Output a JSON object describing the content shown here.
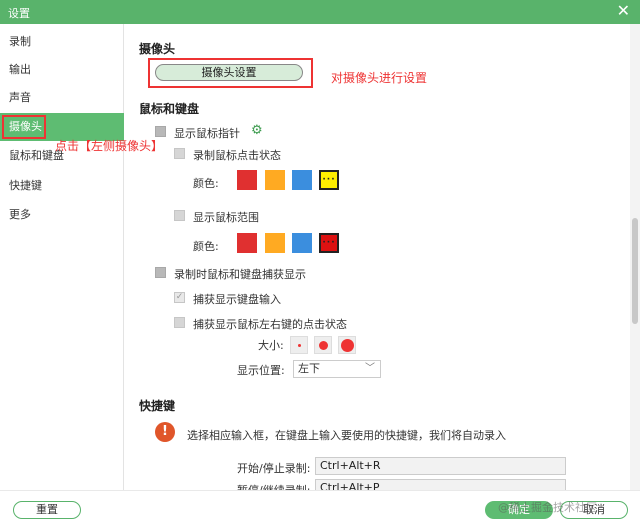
{
  "window": {
    "title": "设置"
  },
  "sidebar": {
    "items": [
      {
        "label": "录制"
      },
      {
        "label": "输出"
      },
      {
        "label": "声音"
      },
      {
        "label": "摄像头"
      },
      {
        "label": "鼠标和键盘"
      },
      {
        "label": "快捷键"
      },
      {
        "label": "更多"
      }
    ],
    "active_index": 3
  },
  "camera": {
    "section_title": "摄像头",
    "button_label": "摄像头设置",
    "annotation_settings": "对摄像头进行设置",
    "annotation_click": "点击【左侧摄像头】"
  },
  "mouse_keyboard": {
    "section_title": "鼠标和键盘",
    "show_cursor": {
      "label": "显示鼠标指针",
      "checked": false
    },
    "record_click": {
      "label": "录制鼠标点击状态",
      "checked": false,
      "color_label": "颜色:"
    },
    "click_colors": [
      "#e03030",
      "#ffaa22",
      "#3b8ede",
      "#ffee00"
    ],
    "show_range": {
      "label": "显示鼠标范围",
      "checked": false,
      "color_label": "颜色:"
    },
    "range_colors": [
      "#e03030",
      "#ffaa22",
      "#3b8ede",
      "#dd1111"
    ],
    "capture_display": {
      "label": "录制时鼠标和键盘捕获显示",
      "checked": false
    },
    "capture_keyboard": {
      "label": "捕获显示键盘输入",
      "checked": true
    },
    "capture_mouse_clicks": {
      "label": "捕获显示鼠标左右键的点击状态",
      "checked": false
    },
    "size_label": "大小:",
    "position_label": "显示位置:",
    "position_value": "左下"
  },
  "hotkeys": {
    "section_title": "快捷键",
    "info": "选择相应输入框，在键盘上输入要使用的快捷键，我们将自动录入",
    "rows": [
      {
        "label": "开始/停止录制:",
        "value": "Ctrl+Alt+R"
      },
      {
        "label": "暂停/继续录制:",
        "value": "Ctrl+Alt+P"
      }
    ]
  },
  "footer": {
    "reset_label": "重置",
    "ok_label": "确定",
    "cancel_label": "取消",
    "watermark": "@稀土掘金技术社区"
  },
  "colors": {
    "accent": "#5ebc72",
    "annotation": "#e33333"
  },
  "icons": {
    "close": "close-icon",
    "gear": "gear-icon",
    "warning": "warning-icon",
    "dropdown": "chevron-down-icon",
    "check": "check-icon"
  }
}
